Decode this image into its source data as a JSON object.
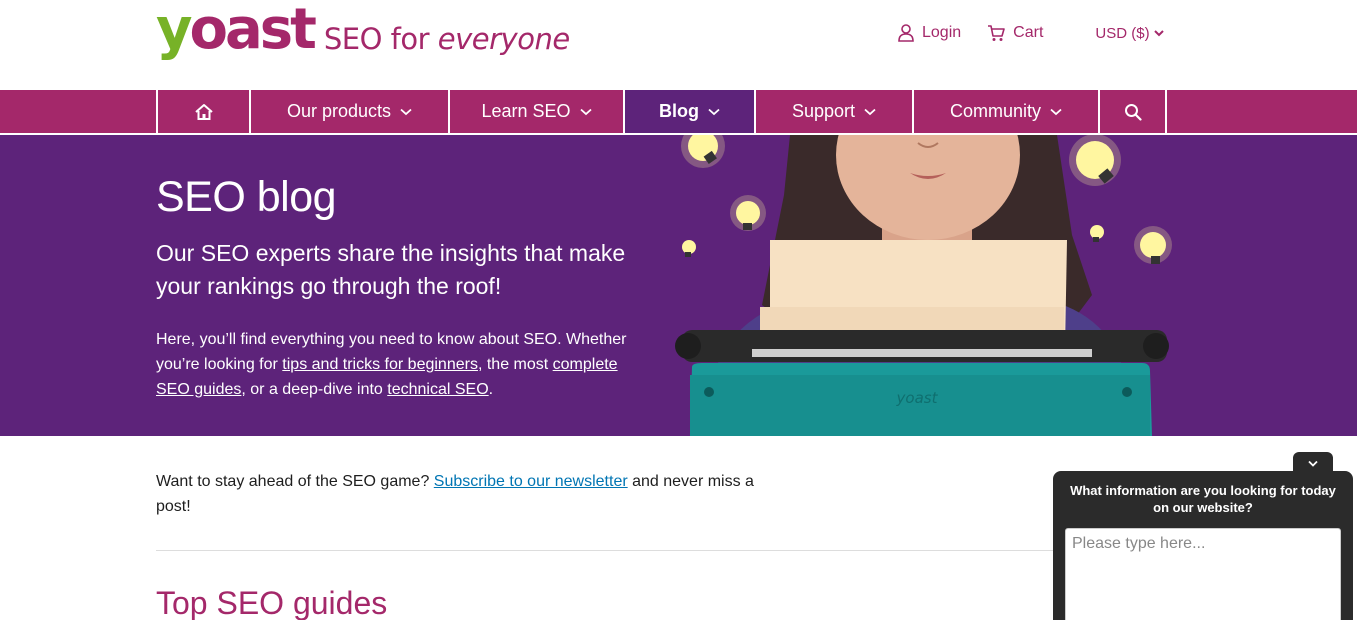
{
  "header": {
    "logo_y": "y",
    "logo_rest": "oast",
    "tagline_prefix": "SEO for",
    "tagline_italic": "everyone",
    "login_label": "Login",
    "cart_label": "Cart",
    "currency_label": "USD ($)"
  },
  "nav": {
    "items": [
      {
        "label": "Our products"
      },
      {
        "label": "Learn SEO"
      },
      {
        "label": "Blog"
      },
      {
        "label": "Support"
      },
      {
        "label": "Community"
      }
    ]
  },
  "hero": {
    "title": "SEO blog",
    "subtitle": "Our SEO experts share the insights that make your rankings go through the roof!",
    "body_1": "Here, you’ll find everything you need to know about SEO. Whether you’re looking for ",
    "link_1": "tips and tricks for beginners",
    "body_2": ", the most ",
    "link_2": "complete SEO guides",
    "body_3": ", or a deep-dive into ",
    "link_3": "technical SEO",
    "body_4": ".",
    "typewriter_brand": "yoast"
  },
  "newsletter": {
    "text_before": "Want to stay ahead of the SEO game? ",
    "link": "Subscribe to our newsletter",
    "text_after": " and never miss a post!"
  },
  "section": {
    "title": "Top SEO guides"
  },
  "chat": {
    "question": "What information are you looking for today on our website?",
    "placeholder": "Please type here..."
  },
  "colors": {
    "brand": "#a4286a",
    "brand_dark": "#5d237a",
    "brand_green": "#77b227",
    "link": "#0075b3",
    "chat_bg": "#2b2b2b"
  }
}
